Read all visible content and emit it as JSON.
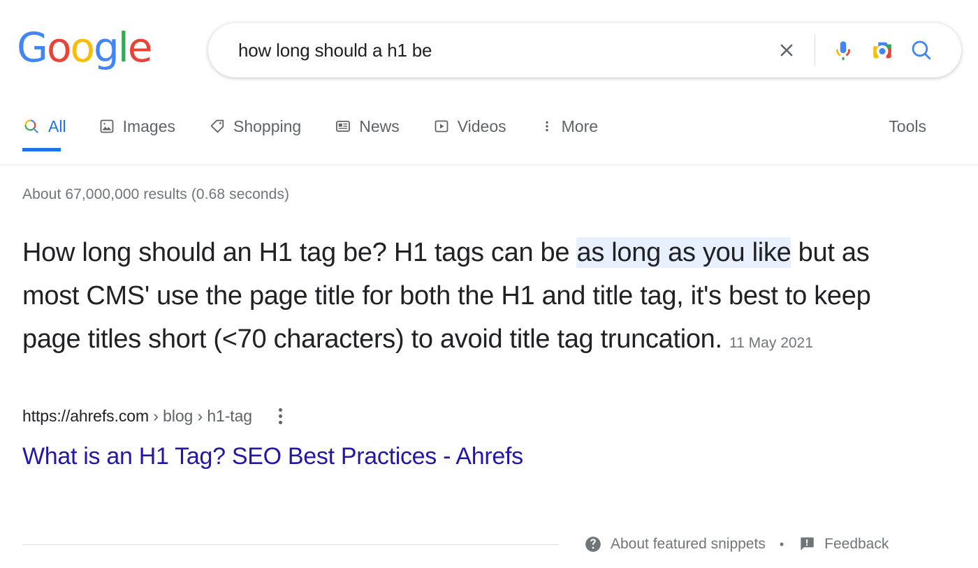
{
  "logo": {
    "letters": [
      {
        "char": "G",
        "color": "#4285F4"
      },
      {
        "char": "o",
        "color": "#EA4335"
      },
      {
        "char": "o",
        "color": "#FBBC05"
      },
      {
        "char": "g",
        "color": "#4285F4"
      },
      {
        "char": "l",
        "color": "#34A853"
      },
      {
        "char": "e",
        "color": "#EA4335"
      }
    ],
    "alt": "Google"
  },
  "search": {
    "value": "how long should a h1 be",
    "placeholder": "Search Google or type a URL",
    "clear_icon": "close-icon",
    "voice_icon": "microphone-icon",
    "lens_icon": "google-lens-camera-icon",
    "submit_icon": "search-icon"
  },
  "nav": {
    "tabs": [
      {
        "label": "All",
        "icon": "google-search-colored-icon",
        "active": true
      },
      {
        "label": "Images",
        "icon": "image-icon",
        "active": false
      },
      {
        "label": "Shopping",
        "icon": "price-tag-icon",
        "active": false
      },
      {
        "label": "News",
        "icon": "newspaper-icon",
        "active": false
      },
      {
        "label": "Videos",
        "icon": "play-box-icon",
        "active": false
      },
      {
        "label": "More",
        "icon": "kebab-menu-icon",
        "active": false
      }
    ],
    "tools_label": "Tools"
  },
  "results": {
    "stats": "About 67,000,000 results (0.68 seconds)",
    "featured_snippet": {
      "text_before": "How long should an H1 tag be? H1 tags can be ",
      "highlight": "as long as you like",
      "text_after": " but as most CMS' use the page title for both the H1 and title tag, it's best to keep page titles short (<70 characters) to avoid title tag truncation.",
      "date": "11 May 2021",
      "highlight_color": "#e8f0fe"
    },
    "source": {
      "domain": "https://ahrefs.com",
      "path": " › blog › h1-tag",
      "menu_icon": "kebab-menu-icon",
      "title": "What is an H1 Tag? SEO Best Practices - Ahrefs",
      "title_color": "#2217a8"
    },
    "footer": {
      "about_icon": "help-circle-icon",
      "about_label": "About featured snippets",
      "separator": "•",
      "feedback_icon": "feedback-flag-icon",
      "feedback_label": "Feedback"
    }
  }
}
